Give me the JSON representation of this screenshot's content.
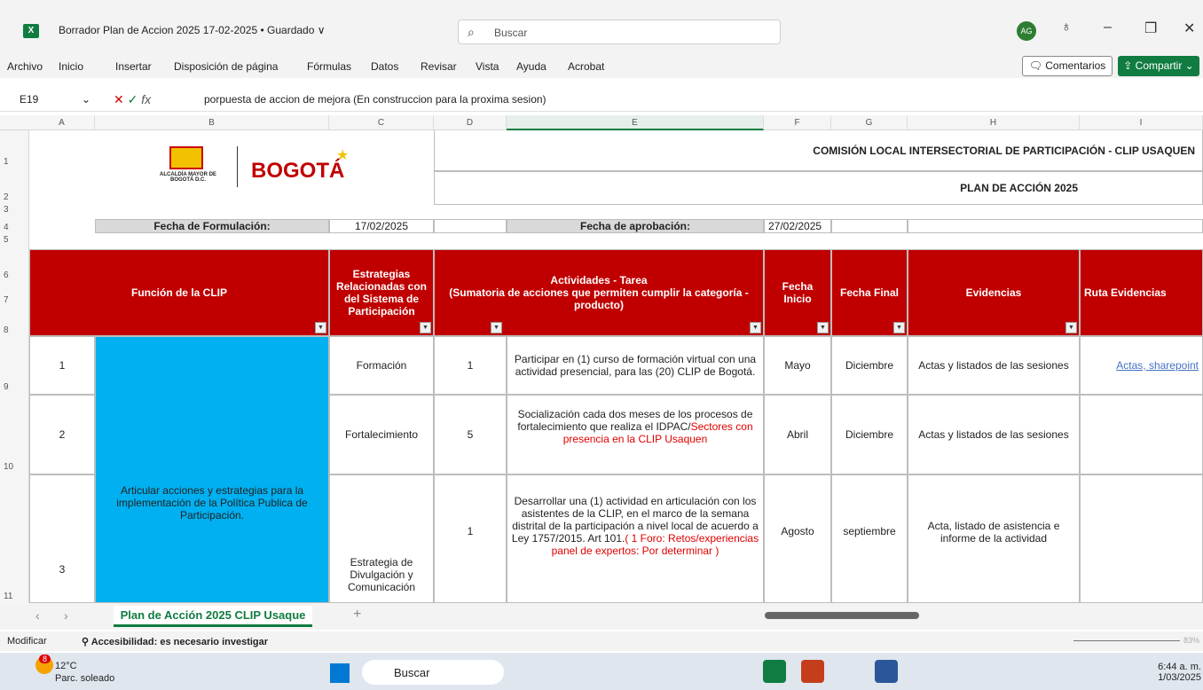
{
  "window": {
    "app_icon": "excel-icon",
    "doc_title": "Borrador Plan de Accion 2025 17-02-2025 • Guardado ∨",
    "search_placeholder": "Buscar",
    "avatar": "AG"
  },
  "menu": [
    "Archivo",
    "Inicio",
    "Insertar",
    "Disposición de página",
    "Fórmulas",
    "Datos",
    "Revisar",
    "Vista",
    "Ayuda",
    "Acrobat"
  ],
  "actions": {
    "comments": "Comentarios",
    "share": "Compartir"
  },
  "formula_bar": {
    "cell_ref": "E19",
    "formula": "porpuesta de accion de mejora  (En construccion para la proxima sesion)"
  },
  "columns": [
    "A",
    "B",
    "C",
    "D",
    "E",
    "F",
    "G",
    "H",
    "I"
  ],
  "rows": [
    "1",
    "2",
    "3",
    "4",
    "5",
    "6",
    "7",
    "8",
    "9",
    "10",
    "11"
  ],
  "header": {
    "logo_text": "BOGOTÁ",
    "logo_sub": "ALCALDÍA MAYOR DE BOGOTÁ D.C.",
    "title1": "COMISIÓN LOCAL INTERSECTORIAL DE PARTICIPACIÓN - CLIP USAQUEN",
    "title2": "PLAN DE ACCIÓN 2025",
    "fecha_formulacion_label": "Fecha de Formulación:",
    "fecha_formulacion": "17/02/2025",
    "fecha_aprobacion_label": "Fecha de aprobación:",
    "fecha_aprobacion": "27/02/2025"
  },
  "table_headers": {
    "funcion": "Función de la CLIP",
    "estrategias": "Estrategias Relacionadas con del Sistema de Participación",
    "actividades": "Actividades - Tarea\n(Sumatoria de acciones que permiten cumplir la categoría - producto)",
    "fecha_inicio": "Fecha Inicio",
    "fecha_final": "Fecha Final",
    "evidencias": "Evidencias",
    "ruta": "Ruta Evidencias"
  },
  "funcion_text": "Articular acciones y estrategias para la implementación de la Política Publica de Participación.",
  "table_rows": [
    {
      "num": "1",
      "estrategia": "Formación",
      "count": "1",
      "actividad": "Participar en (1) curso de formación virtual con una actividad presencial, para las (20) CLIP de Bogotá.",
      "actividad_red": "",
      "inicio": "Mayo",
      "final": "Diciembre",
      "evidencias": "Actas y listados de las sesiones",
      "ruta": "Actas, sharepoint"
    },
    {
      "num": "2",
      "estrategia": "Fortalecimiento",
      "count": "5",
      "actividad": "Socialización cada dos meses de los procesos de fortalecimiento que realiza el IDPAC/",
      "actividad_red": "Sectores con presencia en la CLIP Usaquen",
      "inicio": "Abril",
      "final": "Diciembre",
      "evidencias": "Actas y listados de las sesiones",
      "ruta": ""
    },
    {
      "num": "3",
      "estrategia": "Estrategia de Divulgación y Comunicación",
      "count": "1",
      "actividad": "Desarrollar una (1) actividad en articulación con los asistentes de la CLIP, en el marco de la semana distrital de la participación a nivel local de acuerdo a Ley 1757/2015. Art 101.",
      "actividad_red": "( 1 Foro: Retos/experiencias panel de expertos: Por determinar )",
      "inicio": "Agosto",
      "final": "septiembre",
      "evidencias": "Acta, listado de asistencia e informe de la actividad",
      "ruta": ""
    }
  ],
  "sheet_tab": "Plan de Acción 2025 CLIP Usaque",
  "status": {
    "mode": "Modificar",
    "accessibility": "Accesibilidad: es necesario investigar",
    "zoom": "83%"
  },
  "taskbar": {
    "weather_temp": "12°C",
    "weather_desc": "Parc. soleado",
    "search": "Buscar",
    "time": "6:44 a. m.",
    "date": "1/03/2025",
    "badge": "8"
  },
  "colors": {
    "excel_green": "#107c41",
    "header_red": "#c00000",
    "cyan": "#00b0f0"
  }
}
